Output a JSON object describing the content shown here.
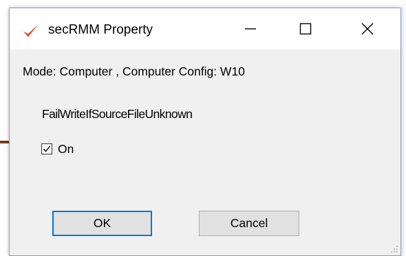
{
  "window": {
    "title": "secRMM Property"
  },
  "titlebar": {
    "minimize_symbol": "—",
    "maximize_symbol": "☐",
    "close_symbol": "✕"
  },
  "content": {
    "mode_line": "Mode: Computer , Computer Config: W10",
    "property_name": "FailWriteIfSourceFileUnknown",
    "checkbox": {
      "label": "On",
      "checked": true
    }
  },
  "buttons": {
    "ok_label": "OK",
    "cancel_label": "Cancel"
  },
  "icons": {
    "app": "checkmark-icon",
    "min": "minimize-icon",
    "max": "maximize-icon",
    "close": "close-icon",
    "check": "check-icon",
    "grip": "resize-grip-icon"
  },
  "colors": {
    "app_icon": "#e8542b",
    "focus_border": "#0078d7",
    "dialog_bg": "#f0f0f0"
  }
}
